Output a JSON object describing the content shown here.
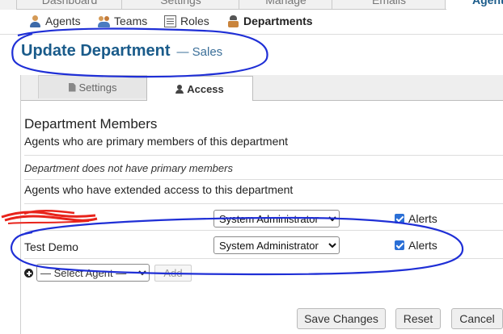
{
  "top_nav": {
    "tabs": [
      {
        "label": "Dashboard"
      },
      {
        "label": "Settings"
      },
      {
        "label": "Manage"
      },
      {
        "label": "Emails"
      },
      {
        "label": "Agents",
        "active": true
      }
    ]
  },
  "sub_nav": {
    "items": [
      {
        "label": "Agents",
        "icon": "agent-icon"
      },
      {
        "label": "Teams",
        "icon": "team-icon"
      },
      {
        "label": "Roles",
        "icon": "roles-icon"
      },
      {
        "label": "Departments",
        "icon": "department-icon",
        "active": true
      }
    ]
  },
  "page": {
    "title": "Update Department",
    "subtitle": "— Sales"
  },
  "tabs": {
    "settings": "Settings",
    "access": "Access"
  },
  "members": {
    "heading": "Department Members",
    "primary_label": "Agents who are primary members of this department",
    "no_primary": "Department does not have primary members",
    "extended_label": "Agents who have extended access to this department",
    "rows": [
      {
        "agent": "",
        "role": "System Administrator",
        "alerts_label": "Alerts",
        "alerts_checked": true
      },
      {
        "agent": "Test Demo",
        "role": "System Administrator",
        "alerts_label": "Alerts",
        "alerts_checked": true
      }
    ],
    "select_agent_placeholder": "— Select Agent —",
    "add_label": "Add"
  },
  "actions": {
    "save": "Save Changes",
    "reset": "Reset",
    "cancel": "Cancel"
  },
  "colors": {
    "title": "#1a5b8a",
    "annotation_ink": "#1f2fd6",
    "redaction_ink": "#e8231b"
  }
}
